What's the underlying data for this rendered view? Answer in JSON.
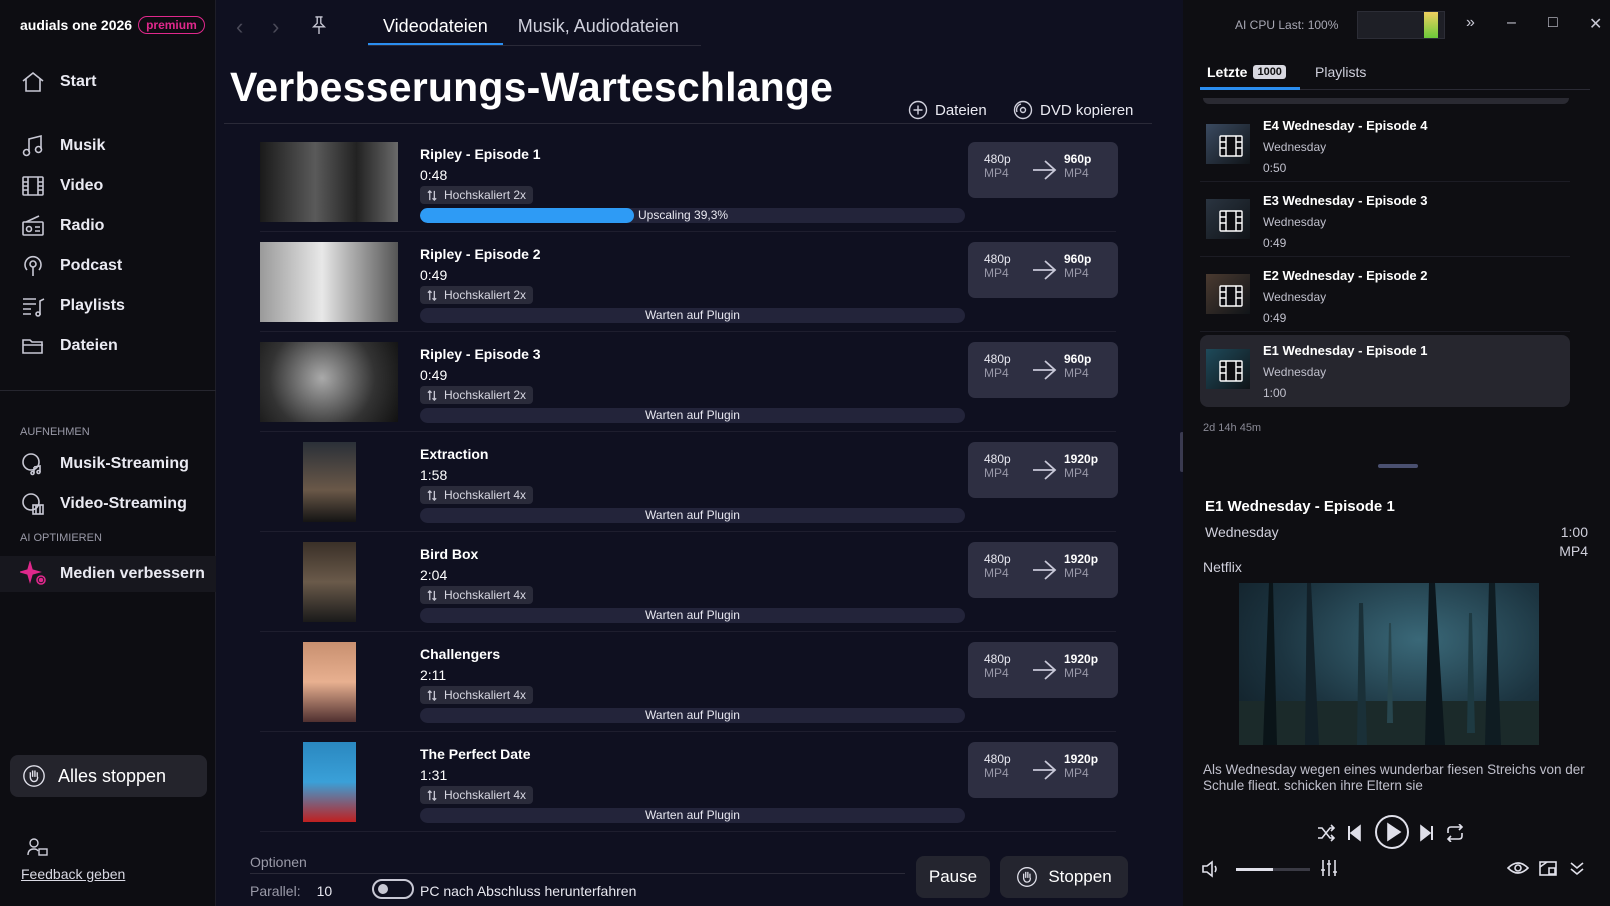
{
  "app": {
    "name": "audials one 2026",
    "edition": "premium"
  },
  "sidebar": {
    "items": [
      {
        "label": "Start",
        "icon": "home-icon"
      },
      {
        "label": "Musik",
        "icon": "music-icon"
      },
      {
        "label": "Video",
        "icon": "film-icon"
      },
      {
        "label": "Radio",
        "icon": "radio-icon"
      },
      {
        "label": "Podcast",
        "icon": "podcast-icon"
      },
      {
        "label": "Playlists",
        "icon": "playlist-icon"
      },
      {
        "label": "Dateien",
        "icon": "folder-icon"
      }
    ],
    "record_section": "AUFNEHMEN",
    "record_items": [
      {
        "label": "Musik-Streaming",
        "icon": "music-streaming-icon"
      },
      {
        "label": "Video-Streaming",
        "icon": "video-streaming-icon"
      }
    ],
    "ai_section": "AI OPTIMIEREN",
    "ai_items": [
      {
        "label": "Medien verbessern",
        "icon": "sparkle-icon"
      }
    ],
    "stop_all": "Alles stoppen",
    "feedback": "Feedback geben"
  },
  "main": {
    "tabs": [
      {
        "label": "Videodateien",
        "active": true
      },
      {
        "label": "Musik, Audiodateien",
        "active": false
      }
    ],
    "title": "Verbesserungs-Warteschlange",
    "actions": {
      "files": "Dateien",
      "dvd": "DVD kopieren"
    },
    "queue": [
      {
        "title": "Ripley - Episode 1",
        "duration": "0:48",
        "upscale": "Hochskaliert 2x",
        "status": "Upscaling 39,3%",
        "progress": 0.393,
        "src_res": "480p",
        "src_fmt": "MP4",
        "dst_res": "960p",
        "dst_fmt": "MP4"
      },
      {
        "title": "Ripley - Episode 2",
        "duration": "0:49",
        "upscale": "Hochskaliert 2x",
        "status": "Warten auf Plugin",
        "progress": 0,
        "src_res": "480p",
        "src_fmt": "MP4",
        "dst_res": "960p",
        "dst_fmt": "MP4"
      },
      {
        "title": "Ripley - Episode 3",
        "duration": "0:49",
        "upscale": "Hochskaliert 2x",
        "status": "Warten auf Plugin",
        "progress": 0,
        "src_res": "480p",
        "src_fmt": "MP4",
        "dst_res": "960p",
        "dst_fmt": "MP4"
      },
      {
        "title": "Extraction",
        "duration": "1:58",
        "upscale": "Hochskaliert 4x",
        "status": "Warten auf Plugin",
        "progress": 0,
        "src_res": "480p",
        "src_fmt": "MP4",
        "dst_res": "1920p",
        "dst_fmt": "MP4"
      },
      {
        "title": "Bird Box",
        "duration": "2:04",
        "upscale": "Hochskaliert 4x",
        "status": "Warten auf Plugin",
        "progress": 0,
        "src_res": "480p",
        "src_fmt": "MP4",
        "dst_res": "1920p",
        "dst_fmt": "MP4"
      },
      {
        "title": "Challengers",
        "duration": "2:11",
        "upscale": "Hochskaliert 4x",
        "status": "Warten auf Plugin",
        "progress": 0,
        "src_res": "480p",
        "src_fmt": "MP4",
        "dst_res": "1920p",
        "dst_fmt": "MP4"
      },
      {
        "title": "The Perfect Date",
        "duration": "1:31",
        "upscale": "Hochskaliert 4x",
        "status": "Warten auf Plugin",
        "progress": 0,
        "src_res": "480p",
        "src_fmt": "MP4",
        "dst_res": "1920p",
        "dst_fmt": "MP4"
      }
    ],
    "options": {
      "label": "Optionen",
      "parallel_label": "Parallel:",
      "parallel_value": "10",
      "shutdown_label": "PC nach Abschluss herunterfahren"
    },
    "pause": "Pause",
    "stop": "Stoppen"
  },
  "right": {
    "cpu_label": "AI CPU Last: 100%",
    "cpu_load": 1.0,
    "tabs": {
      "recent": "Letzte",
      "recent_count": "1000",
      "playlists": "Playlists"
    },
    "recent": [
      {
        "title": "E4 Wednesday - Episode 4",
        "show": "Wednesday",
        "duration": "0:50"
      },
      {
        "title": "E3 Wednesday - Episode 3",
        "show": "Wednesday",
        "duration": "0:49"
      },
      {
        "title": "E2 Wednesday - Episode 2",
        "show": "Wednesday",
        "duration": "0:49"
      },
      {
        "title": "E1 Wednesday - Episode 1",
        "show": "Wednesday",
        "duration": "1:00"
      }
    ],
    "ago": "2d 14h 45m",
    "detail": {
      "title": "E1  Wednesday - Episode 1",
      "show": "Wednesday",
      "duration": "1:00",
      "format": "MP4",
      "source": "Netflix",
      "description": "Als Wednesday wegen eines wunderbar fiesen Streichs von der Schule fliegt, schicken ihre Eltern sie"
    },
    "volume": 0.5
  }
}
